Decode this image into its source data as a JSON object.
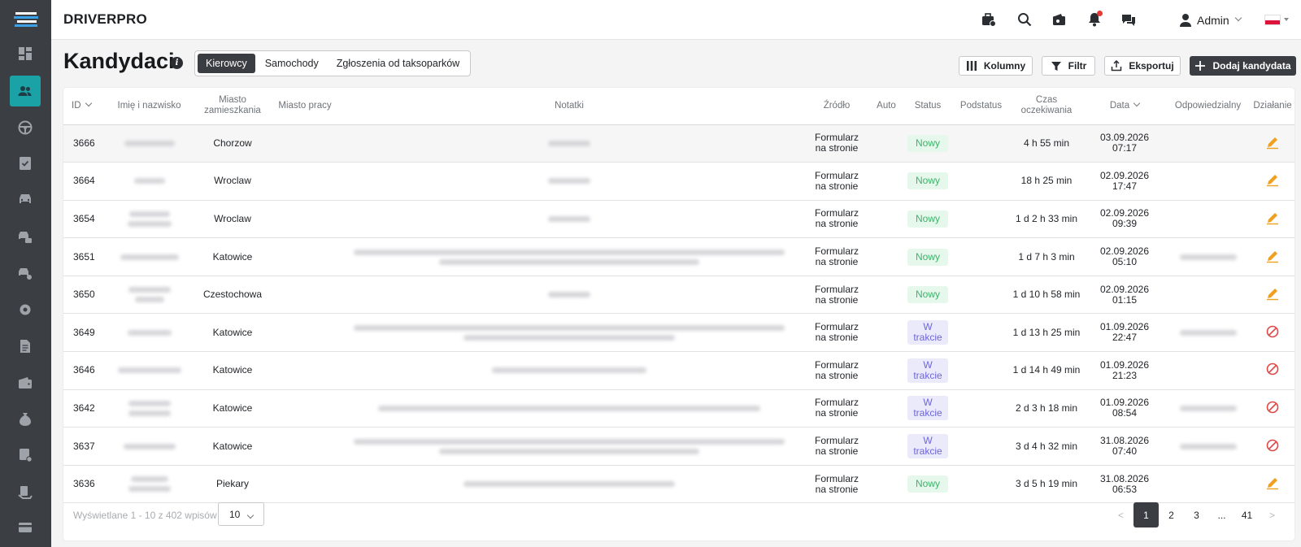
{
  "app": {
    "brand": "DRIVERPRO"
  },
  "topbar": {
    "user_name": "Admin",
    "language_flag": "pl"
  },
  "page": {
    "title": "Kandydaci",
    "tabs": [
      "Kierowcy",
      "Samochody",
      "Zgłoszenia od taksoparków"
    ],
    "active_tab": "Kierowcy"
  },
  "toolbar": {
    "columns_label": "Kolumny",
    "filter_label": "Filtr",
    "export_label": "Eksportuj",
    "add_label": "Dodaj kandydata"
  },
  "table": {
    "headers": {
      "id": "ID",
      "name": "Imię i nazwisko",
      "city_home": "Miasto zamieszkania",
      "city_work": "Miasto pracy",
      "notes": "Notatki",
      "source": "Źródło",
      "car": "Auto",
      "status": "Status",
      "substatus": "Podstatus",
      "wait": "Czas oczekiwania",
      "date": "Data",
      "owner": "Odpowiedzialny",
      "action": "Działanie"
    },
    "rows": [
      {
        "id": "3666",
        "city": "Chorzow",
        "source": "Formularz na stronie",
        "status": "Nowy",
        "wait": "4 h 55 min",
        "date": "03.09.2026",
        "time": "07:17",
        "action": "edit"
      },
      {
        "id": "3664",
        "city": "Wroclaw",
        "source": "Formularz na stronie",
        "status": "Nowy",
        "wait": "18 h 25 min",
        "date": "02.09.2026",
        "time": "17:47",
        "action": "edit"
      },
      {
        "id": "3654",
        "city": "Wroclaw",
        "source": "Formularz na stronie",
        "status": "Nowy",
        "wait": "1 d 2 h 33 min",
        "date": "02.09.2026",
        "time": "09:39",
        "action": "edit"
      },
      {
        "id": "3651",
        "city": "Katowice",
        "source": "Formularz na stronie",
        "status": "Nowy",
        "wait": "1 d 7 h 3 min",
        "date": "02.09.2026",
        "time": "05:10",
        "action": "edit"
      },
      {
        "id": "3650",
        "city": "Czestochowa",
        "source": "Formularz na stronie",
        "status": "Nowy",
        "wait": "1 d 10 h 58 min",
        "date": "02.09.2026",
        "time": "01:15",
        "action": "edit"
      },
      {
        "id": "3649",
        "city": "Katowice",
        "source": "Formularz na stronie",
        "status": "W trakcie",
        "wait": "1 d 13 h 25 min",
        "date": "01.09.2026",
        "time": "22:47",
        "action": "block"
      },
      {
        "id": "3646",
        "city": "Katowice",
        "source": "Formularz na stronie",
        "status": "W trakcie",
        "wait": "1 d 14 h 49 min",
        "date": "01.09.2026",
        "time": "21:23",
        "action": "block"
      },
      {
        "id": "3642",
        "city": "Katowice",
        "source": "Formularz na stronie",
        "status": "W trakcie",
        "wait": "2 d 3 h 18 min",
        "date": "01.09.2026",
        "time": "08:54",
        "action": "block"
      },
      {
        "id": "3637",
        "city": "Katowice",
        "source": "Formularz na stronie",
        "status": "W trakcie",
        "wait": "3 d 4 h 32 min",
        "date": "31.08.2026",
        "time": "07:40",
        "action": "block"
      },
      {
        "id": "3636",
        "city": "Piekary",
        "source": "Formularz na stronie",
        "status": "Nowy",
        "wait": "3 d 5 h 19 min",
        "date": "31.08.2026",
        "time": "06:53",
        "action": "edit"
      }
    ]
  },
  "footer": {
    "info": "Wyświetlane 1 - 10 z 402 wpisów",
    "page_size": "10",
    "pages": [
      "1",
      "2",
      "3",
      "...",
      "41"
    ],
    "current_page": "1",
    "prev": "<",
    "next": ">"
  },
  "colors": {
    "sidebar": "#3b3f44",
    "accent": "#1ba2a6",
    "status_new": "#3cb36a",
    "status_progress": "#6d66d8",
    "edit_icon": "#f0a020",
    "block_icon": "#e04848"
  }
}
